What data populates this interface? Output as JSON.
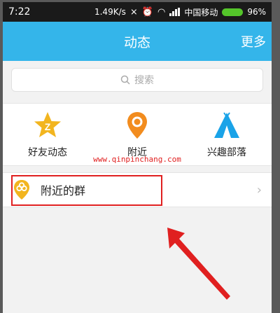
{
  "status": {
    "time": "7:22",
    "speed": "1.49K/s",
    "carrier": "中国移动",
    "battery": "96%"
  },
  "header": {
    "title": "动态",
    "more": "更多"
  },
  "search": {
    "placeholder": "搜索"
  },
  "shortcuts": [
    {
      "label": "好友动态",
      "icon": "friends-star-icon",
      "color": "#f2b51f"
    },
    {
      "label": "附近",
      "icon": "location-pin-icon",
      "color": "#f28c1e"
    },
    {
      "label": "兴趣部落",
      "icon": "tent-icon",
      "color": "#1aa3e8"
    }
  ],
  "watermark": "www.qinpinchang.com",
  "list": [
    {
      "label": "附近的群",
      "icon": "nearby-group-icon",
      "color": "#f2b51f"
    }
  ],
  "colors": {
    "accent": "#34b5ea",
    "highlight": "#e02020"
  }
}
